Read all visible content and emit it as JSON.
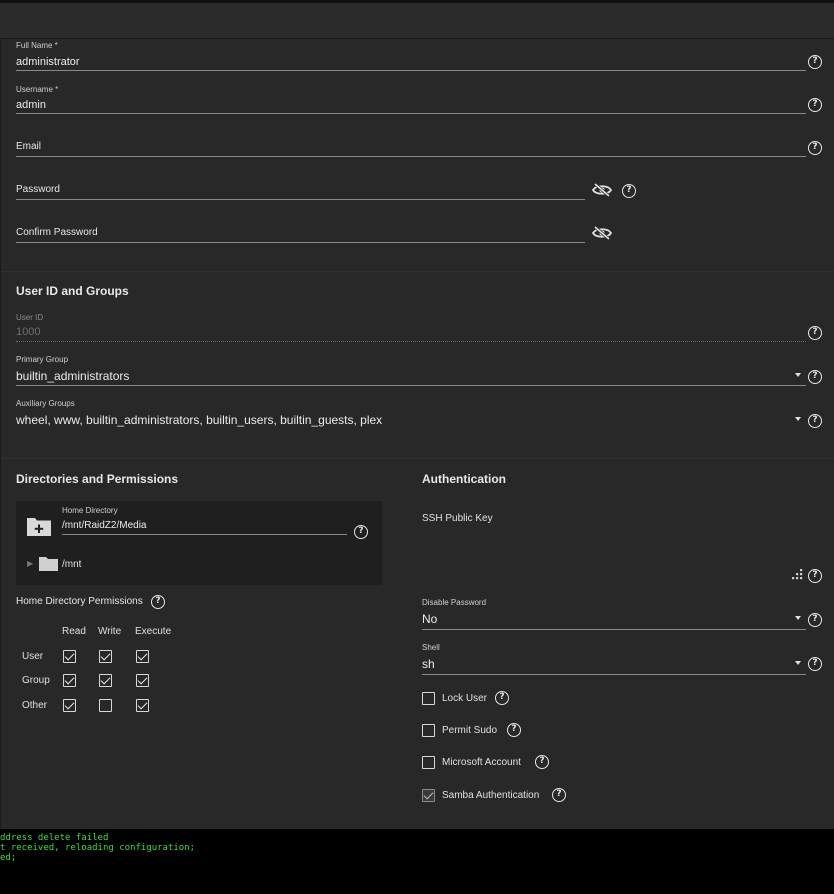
{
  "account": {
    "full_name_label": "Full Name *",
    "full_name_value": "administrator",
    "username_label": "Username *",
    "username_value": "admin",
    "email_label": "Email",
    "password_label": "Password",
    "confirm_password_label": "Confirm Password"
  },
  "ids_groups": {
    "title": "User ID and Groups",
    "user_id_label": "User ID",
    "user_id_value": "1000",
    "primary_group_label": "Primary Group",
    "primary_group_value": "builtin_administrators",
    "aux_groups_label": "Auxiliary Groups",
    "aux_groups_value": "wheel, www, builtin_administrators, builtin_users, builtin_guests, plex"
  },
  "directories": {
    "title": "Directories and Permissions",
    "home_dir_label": "Home Directory",
    "home_dir_value": "/mnt/RaidZ2/Media",
    "tree_root": "/mnt",
    "permissions_label": "Home Directory Permissions",
    "columns": [
      "Read",
      "Write",
      "Execute"
    ],
    "rows": [
      {
        "label": "User",
        "read": true,
        "write": true,
        "execute": true
      },
      {
        "label": "Group",
        "read": true,
        "write": true,
        "execute": true
      },
      {
        "label": "Other",
        "read": true,
        "write": false,
        "execute": true
      }
    ]
  },
  "authentication": {
    "title": "Authentication",
    "ssh_key_label": "SSH Public Key",
    "disable_password_label": "Disable Password",
    "disable_password_value": "No",
    "shell_label": "Shell",
    "shell_value": "sh",
    "checkboxes": [
      {
        "label": "Lock User",
        "checked": false
      },
      {
        "label": "Permit Sudo",
        "checked": false
      },
      {
        "label": "Microsoft Account",
        "checked": false
      },
      {
        "label": "Samba Authentication",
        "checked": true
      }
    ]
  },
  "terminal": {
    "lines": [
      "ddress delete failed",
      "t received, reloading configuration;",
      "ed;"
    ]
  },
  "icons": {
    "help": "?",
    "eye_off": "eye-off-icon",
    "folder_plus": "folder-plus-icon",
    "folder": "folder-icon"
  }
}
